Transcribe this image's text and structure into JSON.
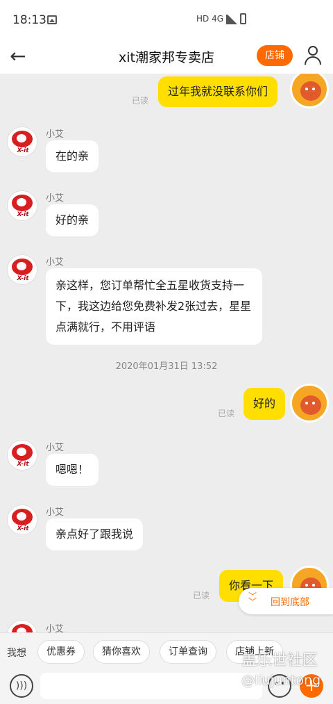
{
  "status_bar": {
    "time": "18:13",
    "network": "HD 4G"
  },
  "header": {
    "title": "xit潮家邦专卖店",
    "store_button": "店铺"
  },
  "chat": {
    "read_label": "已读",
    "store_sender": "小艾",
    "store_logo_text": "X-it",
    "messages": [
      {
        "side": "right",
        "text": "过年我就没联系你们"
      },
      {
        "side": "left",
        "text": "在的亲"
      },
      {
        "side": "left",
        "text": "好的亲"
      },
      {
        "side": "left",
        "text": "亲这样，您订单帮忙全五星收货支持一下，我这边给您免费补发2张过去，星星点满就行，不用评语"
      },
      {
        "side": "right",
        "text": "好的"
      },
      {
        "side": "left",
        "text": "嗯嗯！"
      },
      {
        "side": "left",
        "text": "亲点好了跟我说"
      },
      {
        "side": "right",
        "text": "你看一下"
      }
    ],
    "timestamp": "2020年01月31日 13:52",
    "scroll_bottom_label": "回到底部"
  },
  "quick_bar": {
    "prefix": "我想",
    "chips": [
      "优惠券",
      "猜你喜欢",
      "订单查询",
      "店铺上新"
    ]
  },
  "watermark": {
    "line1": "盖乐世社区",
    "line2": "@liujuntong"
  },
  "colors": {
    "accent": "#ff6a00",
    "my_bubble": "#ffde00",
    "background": "#ededed"
  }
}
